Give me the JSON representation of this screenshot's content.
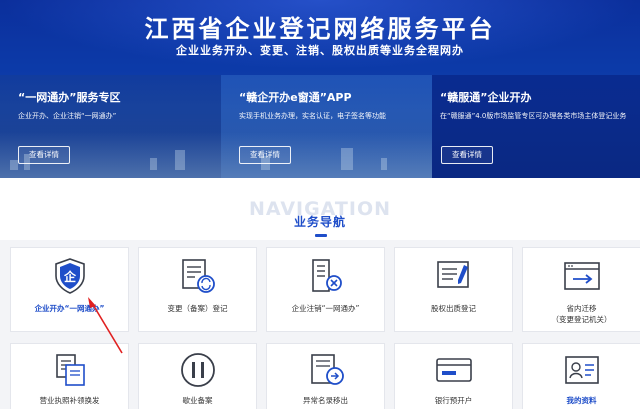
{
  "hero": {
    "title": "江西省企业登记网络服务平台",
    "subtitle": "企业业务开办、变更、注销、股权出质等业务全程网办",
    "panels": [
      {
        "title": "“一网通办”服务专区",
        "desc": "企业开办、企业注销“一网通办”",
        "button": "查看详情"
      },
      {
        "title": "“赣企开办e窗通”APP",
        "desc": "实现手机业务办理，实名认证，电子签名等功能",
        "button": "查看详情"
      },
      {
        "title": "“赣服通”企业开办",
        "desc": "在“赣服通”4.0版市场监管专区可办理各类市场主体登记业务",
        "button": "查看详情"
      }
    ]
  },
  "nav": {
    "bg_word": "NAVIGATION",
    "title": "业务导航"
  },
  "cards": [
    {
      "label": "企业开办“一网通办”",
      "icon": "shield-qi-icon"
    },
    {
      "label": "变更（备案）登记",
      "icon": "document-refresh-icon"
    },
    {
      "label": "企业注销“一网通办”",
      "icon": "building-cancel-icon"
    },
    {
      "label": "股权出质登记",
      "icon": "certificate-pen-icon"
    },
    {
      "label": "省内迁移",
      "sub": "（变更登记机关）",
      "icon": "window-arrow-icon"
    },
    {
      "label": "营业执照补领换发",
      "icon": "license-copy-icon"
    },
    {
      "label": "歇业备案",
      "icon": "pause-icon"
    },
    {
      "label": "异常名录移出",
      "icon": "list-arrow-icon"
    },
    {
      "label": "银行预开户",
      "icon": "bank-card-icon"
    },
    {
      "label": "我的资料",
      "icon": "profile-card-icon"
    }
  ],
  "colors": {
    "brand": "#1f4ec9",
    "hero": "#0c3aa8",
    "annotation": "#e02020"
  }
}
